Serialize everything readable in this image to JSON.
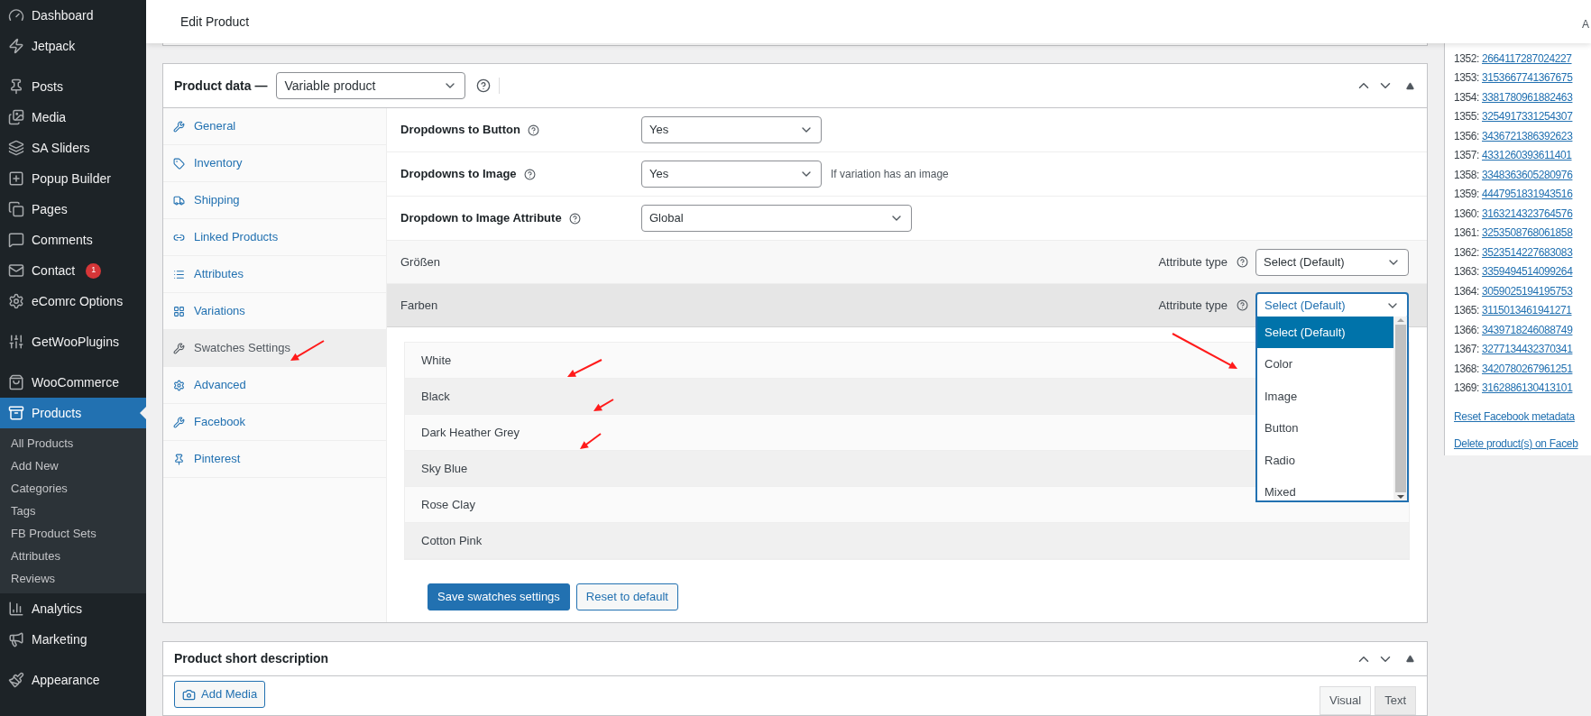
{
  "sidebar": {
    "groups": [
      [
        {
          "label": "Dashboard",
          "selected": false
        },
        {
          "label": "Jetpack",
          "selected": false
        }
      ],
      [
        {
          "label": "Posts",
          "selected": false
        },
        {
          "label": "Media",
          "selected": false
        },
        {
          "label": "SA Sliders",
          "selected": false
        },
        {
          "label": "Popup Builder",
          "selected": false
        },
        {
          "label": "Pages",
          "selected": false
        },
        {
          "label": "Comments",
          "selected": false
        },
        {
          "label": "Contact",
          "selected": false,
          "badge": "1"
        },
        {
          "label": "eComrc Options",
          "selected": false
        }
      ],
      [
        {
          "label": "GetWooPlugins",
          "selected": false
        }
      ],
      [
        {
          "label": "WooCommerce",
          "selected": false
        },
        {
          "label": "Products",
          "selected": true,
          "children": [
            {
              "label": "All Products",
              "selected": false
            },
            {
              "label": "Add New",
              "selected": false
            },
            {
              "label": "Categories",
              "selected": false
            },
            {
              "label": "Tags",
              "selected": false
            },
            {
              "label": "FB Product Sets",
              "selected": false
            },
            {
              "label": "Attributes",
              "selected": false
            },
            {
              "label": "Reviews",
              "selected": false
            }
          ]
        },
        {
          "label": "Analytics",
          "selected": false
        },
        {
          "label": "Marketing",
          "selected": false
        }
      ],
      [
        {
          "label": "Appearance",
          "selected": false
        }
      ]
    ]
  },
  "header": {
    "title": "Edit Product",
    "corner_text": "A"
  },
  "product_data": {
    "title": "Product data —",
    "type_select": "Variable product",
    "tabs": [
      {
        "label": "General",
        "selected": false
      },
      {
        "label": "Inventory",
        "selected": false
      },
      {
        "label": "Shipping",
        "selected": false
      },
      {
        "label": "Linked Products",
        "selected": false
      },
      {
        "label": "Attributes",
        "selected": false
      },
      {
        "label": "Variations",
        "selected": false
      },
      {
        "label": "Swatches Settings",
        "selected": true
      },
      {
        "label": "Advanced",
        "selected": false
      },
      {
        "label": "Facebook",
        "selected": false
      },
      {
        "label": "Pinterest",
        "selected": false
      }
    ],
    "settings": [
      {
        "label": "Dropdowns to Button",
        "value": "Yes",
        "wide": false
      },
      {
        "label": "Dropdowns to Image",
        "value": "Yes",
        "wide": false,
        "note": "If variation has an image"
      },
      {
        "label": "Dropdown to Image Attribute",
        "value": "Global",
        "wide": true
      }
    ],
    "attributes": [
      {
        "name": "Größen",
        "type_label": "Attribute type",
        "value": "Select (Default)",
        "expanded": false
      },
      {
        "name": "Farben",
        "type_label": "Attribute type",
        "value": "Select (Default)",
        "expanded": true,
        "options": [
          {
            "label": "Select (Default)",
            "selected": true
          },
          {
            "label": "Color",
            "selected": false
          },
          {
            "label": "Image",
            "selected": false
          },
          {
            "label": "Button",
            "selected": false
          },
          {
            "label": "Radio",
            "selected": false
          },
          {
            "label": "Mixed",
            "selected": false
          }
        ],
        "terms": [
          "White",
          "Black",
          "Dark Heather Grey",
          "Sky Blue",
          "Rose Clay",
          "Cotton Pink"
        ]
      }
    ],
    "buttons": [
      {
        "label": "Save swatches settings",
        "kind": "primary"
      },
      {
        "label": "Reset to default",
        "kind": "secondary"
      }
    ]
  },
  "short_description": {
    "title": "Product short description",
    "add_media": "Add Media",
    "tabs": [
      {
        "label": "Visual",
        "selected": true
      },
      {
        "label": "Text",
        "selected": false
      }
    ]
  },
  "facebook_panel": {
    "ids": [
      {
        "index": "1352:",
        "id": "2664117287024227"
      },
      {
        "index": "1353:",
        "id": "3153667741367675"
      },
      {
        "index": "1354:",
        "id": "3381780961882463"
      },
      {
        "index": "1355:",
        "id": "3254917331254307"
      },
      {
        "index": "1356:",
        "id": "3436721386392623"
      },
      {
        "index": "1357:",
        "id": "4331260393611401"
      },
      {
        "index": "1358:",
        "id": "3348363605280976"
      },
      {
        "index": "1359:",
        "id": "4447951831943516"
      },
      {
        "index": "1360:",
        "id": "3163214323764576"
      },
      {
        "index": "1361:",
        "id": "3253508768061858"
      },
      {
        "index": "1362:",
        "id": "3523514227683083"
      },
      {
        "index": "1363:",
        "id": "3359494514099264"
      },
      {
        "index": "1364:",
        "id": "3059025194195753"
      },
      {
        "index": "1365:",
        "id": "3115013461941271"
      },
      {
        "index": "1366:",
        "id": "3439718246088749"
      },
      {
        "index": "1367:",
        "id": "3277134432370341"
      },
      {
        "index": "1368:",
        "id": "3420780267961251"
      },
      {
        "index": "1369:",
        "id": "3162886130413101"
      }
    ],
    "links": [
      "Reset Facebook metadata",
      "Delete product(s) on Faceb"
    ]
  }
}
